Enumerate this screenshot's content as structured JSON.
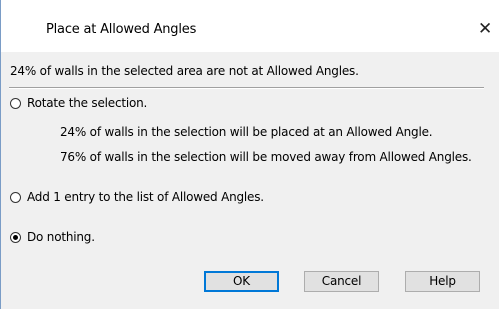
{
  "dialog": {
    "title": "Place at Allowed Angles",
    "close_glyph": "✕",
    "summary": "24% of walls in the selected area are not at Allowed Angles.",
    "options": [
      {
        "label": "Rotate the selection.",
        "checked": false,
        "details": [
          "24% of walls in the selection will be placed at an Allowed Angle.",
          "76% of walls in the selection will be moved away from Allowed Angles."
        ]
      },
      {
        "label": "Add 1 entry to the list of Allowed Angles.",
        "checked": false
      },
      {
        "label": "Do nothing.",
        "checked": true
      }
    ],
    "buttons": {
      "ok": "OK",
      "cancel": "Cancel",
      "help": "Help"
    }
  }
}
